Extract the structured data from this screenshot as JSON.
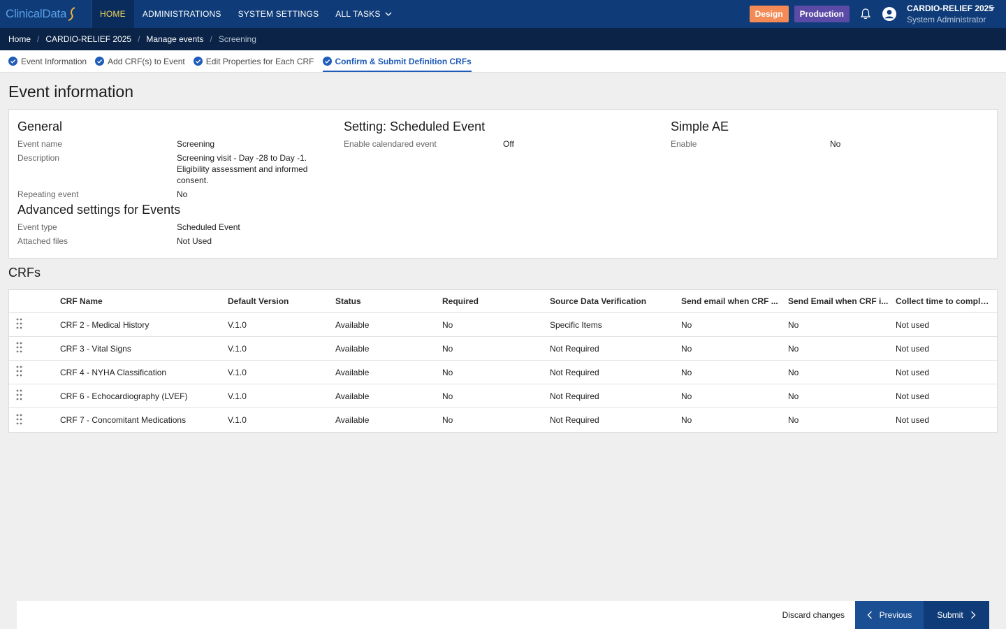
{
  "app": {
    "logo_text": "ClinicalData",
    "logo_icon": "swoosh-logo-icon"
  },
  "nav": {
    "items": [
      {
        "label": "HOME",
        "active": true
      },
      {
        "label": "ADMINISTRATIONS"
      },
      {
        "label": "SYSTEM SETTINGS"
      },
      {
        "label": "ALL TASKS"
      }
    ]
  },
  "header": {
    "design_badge": "Design",
    "production_badge": "Production",
    "study_name": "CARDIO-RELIEF 2025",
    "user_role": "System Administrator"
  },
  "breadcrumb": [
    "Home",
    "CARDIO-RELIEF 2025",
    "Manage events",
    "Screening"
  ],
  "steps": [
    {
      "label": "Event Information"
    },
    {
      "label": "Add CRF(s) to Event"
    },
    {
      "label": "Edit Properties for Each CRF"
    },
    {
      "label": "Confirm & Submit Definition CRFs",
      "active": true
    }
  ],
  "page_title": "Event information",
  "general": {
    "title": "General",
    "event_name_label": "Event name",
    "event_name": "Screening",
    "description_label": "Description",
    "description": "Screening visit - Day -28 to Day -1. Eligibility assessment and informed consent.",
    "repeating_label": "Repeating event",
    "repeating": "No"
  },
  "advanced": {
    "title": "Advanced settings for Events",
    "event_type_label": "Event type",
    "event_type": "Scheduled Event",
    "attached_label": "Attached files",
    "attached": "Not Used"
  },
  "setting": {
    "title": "Setting: Scheduled Event",
    "calendared_label": "Enable calendared event",
    "calendared": "Off"
  },
  "simple_ae": {
    "title": "Simple AE",
    "enable_label": "Enable",
    "enable": "No"
  },
  "crfs": {
    "title": "CRFs",
    "columns": [
      "CRF Name",
      "Default Version",
      "Status",
      "Required",
      "Source Data Verification",
      "Send email when CRF ...",
      "Send Email when CRF i...",
      "Collect time to complet..."
    ],
    "rows": [
      [
        "CRF 2 - Medical History",
        "V.1.0",
        "Available",
        "No",
        "Specific Items",
        "No",
        "No",
        "Not used"
      ],
      [
        "CRF 3 - Vital Signs",
        "V.1.0",
        "Available",
        "No",
        "Not Required",
        "No",
        "No",
        "Not used"
      ],
      [
        "CRF 4 - NYHA Classification",
        "V.1.0",
        "Available",
        "No",
        "Not Required",
        "No",
        "No",
        "Not used"
      ],
      [
        "CRF 6 - Echocardiography (LVEF)",
        "V.1.0",
        "Available",
        "No",
        "Not Required",
        "No",
        "No",
        "Not used"
      ],
      [
        "CRF 7 - Concomitant Medications",
        "V.1.0",
        "Available",
        "No",
        "Not Required",
        "No",
        "No",
        "Not used"
      ]
    ]
  },
  "footer": {
    "discard": "Discard changes",
    "previous": "Previous",
    "submit": "Submit"
  },
  "colors": {
    "nav_bg": "#0f3c78",
    "breadcrumb_bg": "#0a2347",
    "accent": "#1f5bb8",
    "design_badge": "#f48a55",
    "production_badge": "#5b4aa6"
  }
}
